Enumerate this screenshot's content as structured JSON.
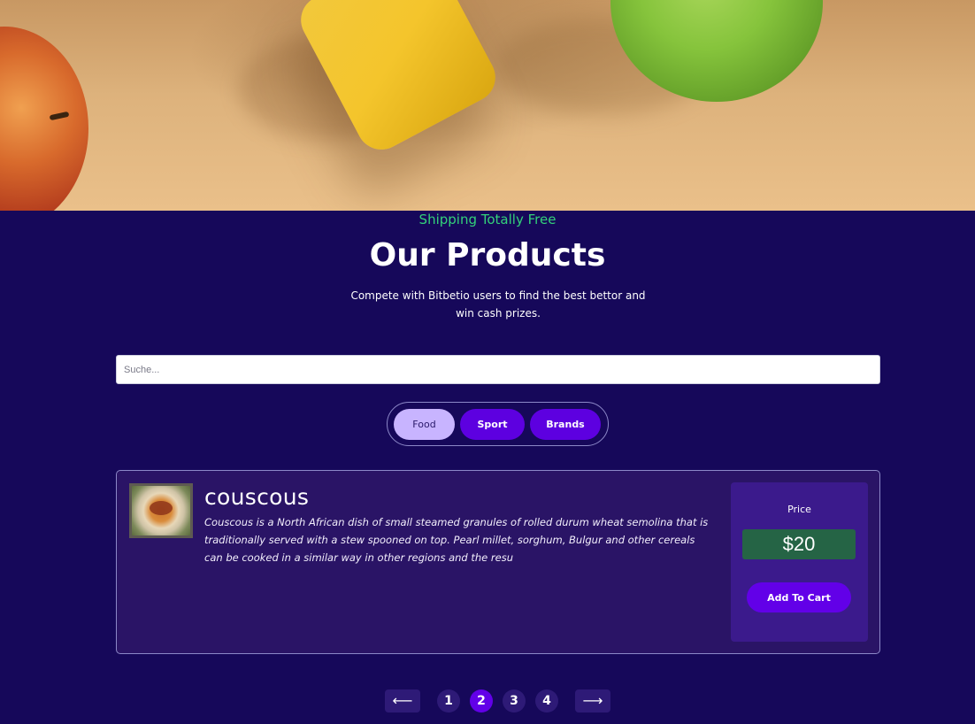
{
  "hero": {
    "image": "fruit-and-dumbbell-photo"
  },
  "header": {
    "tagline": "Shipping Totally Free",
    "title": "Our Products",
    "subtitle": "Compete with Bitbetio users to find the best bettor and win cash prizes."
  },
  "search": {
    "placeholder": "Suche...",
    "value": ""
  },
  "categories": [
    {
      "label": "Food",
      "active": true
    },
    {
      "label": "Sport",
      "active": false
    },
    {
      "label": "Brands",
      "active": false
    }
  ],
  "product": {
    "image": "couscous-dish-thumbnail",
    "name": "couscous",
    "description": "Couscous is a North African dish of small steamed granules of rolled durum wheat semolina that is traditionally served with a stew spooned on top. Pearl millet, sorghum, Bulgur and other cereals can be cooked in a similar way in other regions and the resu",
    "price_label": "Price",
    "price": "$20",
    "add_to_cart_label": "Add To Cart"
  },
  "pagination": {
    "prev": "⟵",
    "next": "⟶",
    "pages": [
      "1",
      "2",
      "3",
      "4"
    ],
    "current": "2"
  },
  "colors": {
    "background": "#16085a",
    "accent": "#6200e8",
    "tagline": "#33d17a",
    "price_bg": "#256445",
    "active_pill": "#c8b4ff"
  }
}
